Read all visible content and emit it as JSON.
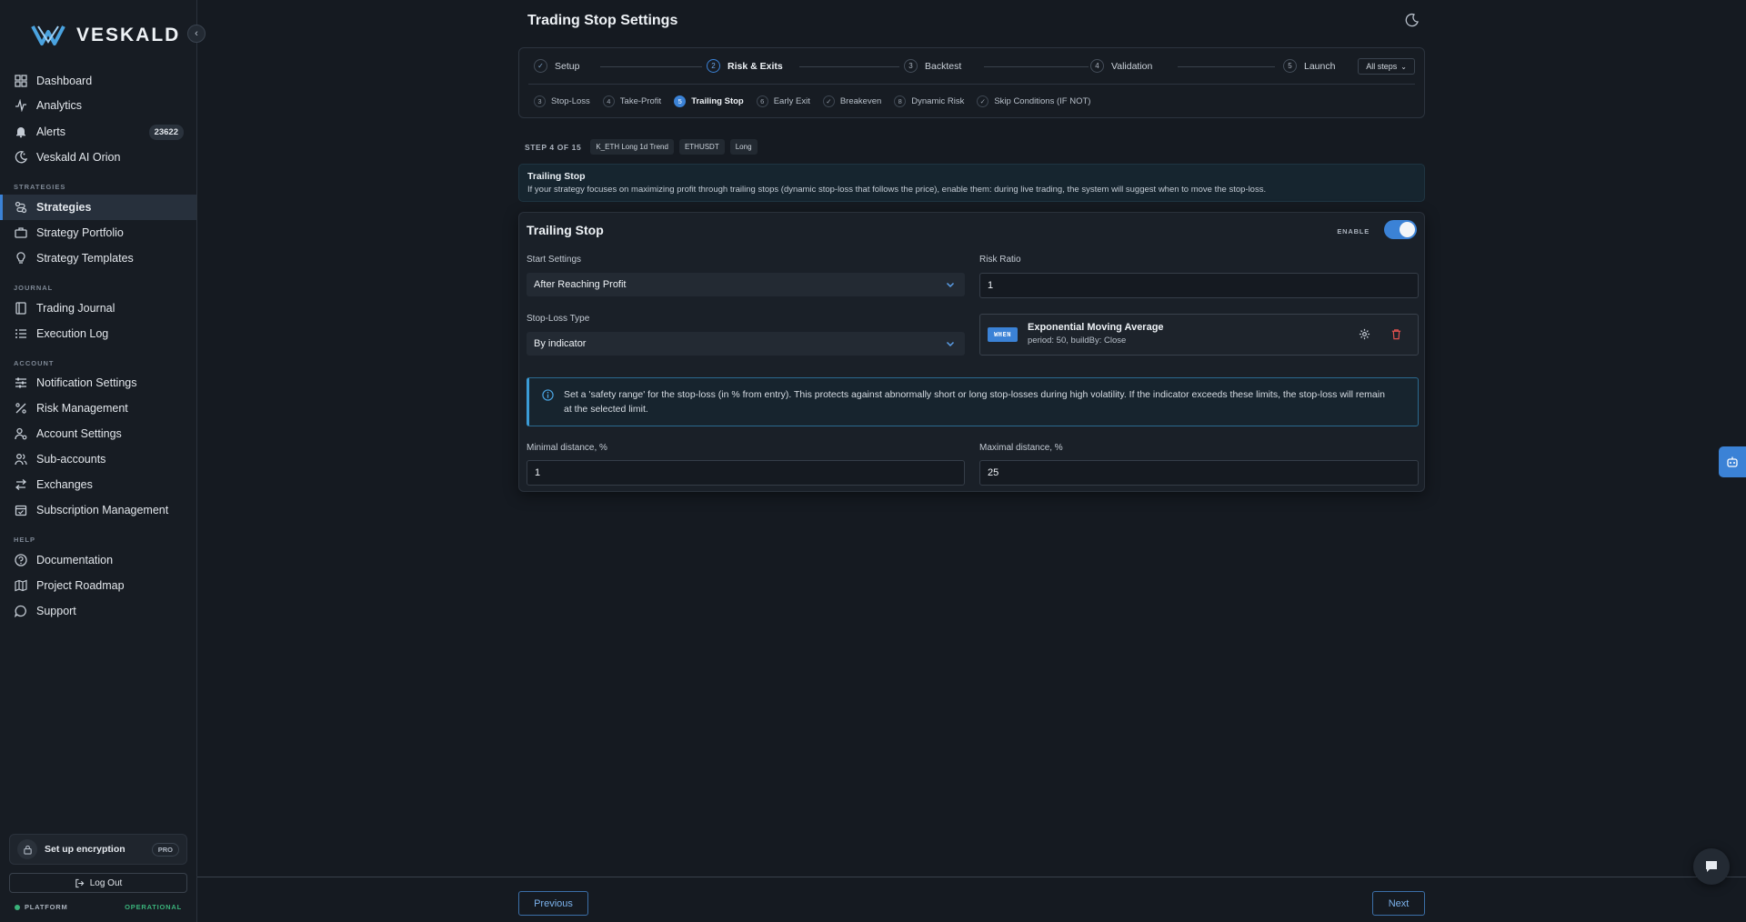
{
  "brand": {
    "name": "VESKALD"
  },
  "sidebar": {
    "main_items": [
      {
        "label": "Dashboard",
        "icon": "dashboard-icon"
      },
      {
        "label": "Analytics",
        "icon": "analytics-icon"
      },
      {
        "label": "Alerts",
        "icon": "bell-icon",
        "badge": "23622"
      },
      {
        "label": "Veskald AI Orion",
        "icon": "ai-orion-icon"
      }
    ],
    "sections": {
      "strategies": "STRATEGIES",
      "journal": "JOURNAL",
      "account": "ACCOUNT",
      "help": "HELP"
    },
    "strategies_items": [
      {
        "label": "Strategies",
        "active": true
      },
      {
        "label": "Strategy Portfolio"
      },
      {
        "label": "Strategy Templates"
      }
    ],
    "journal_items": [
      {
        "label": "Trading Journal"
      },
      {
        "label": "Execution Log"
      }
    ],
    "account_items": [
      {
        "label": "Notification Settings"
      },
      {
        "label": "Risk Management"
      },
      {
        "label": "Account Settings"
      },
      {
        "label": "Sub-accounts"
      },
      {
        "label": "Exchanges"
      },
      {
        "label": "Subscription Management"
      }
    ],
    "help_items": [
      {
        "label": "Documentation"
      },
      {
        "label": "Project Roadmap"
      },
      {
        "label": "Support"
      }
    ],
    "encryption": {
      "label": "Set up encryption",
      "badge": "PRO"
    },
    "logout": "Log Out",
    "platform": {
      "label": "PLATFORM",
      "status": "OPERATIONAL",
      "status_color": "#3ab27a"
    }
  },
  "page": {
    "title": "Trading Stop Settings"
  },
  "stepper": {
    "steps": [
      {
        "num": "✓",
        "label": "Setup"
      },
      {
        "num": "2",
        "label": "Risk & Exits",
        "current": true
      },
      {
        "num": "3",
        "label": "Backtest"
      },
      {
        "num": "4",
        "label": "Validation"
      },
      {
        "num": "5",
        "label": "Launch"
      }
    ],
    "all_steps": "All steps",
    "substeps": [
      {
        "num": "3",
        "label": "Stop-Loss"
      },
      {
        "num": "4",
        "label": "Take-Profit"
      },
      {
        "num": "5",
        "label": "Trailing Stop",
        "current": true
      },
      {
        "num": "6",
        "label": "Early Exit"
      },
      {
        "num": "✓",
        "label": "Breakeven"
      },
      {
        "num": "8",
        "label": "Dynamic Risk"
      },
      {
        "num": "✓",
        "label": "Skip Conditions (IF NOT)"
      }
    ]
  },
  "meta": {
    "step_label": "STEP 4 OF 15",
    "chips": [
      "K_ETH Long 1d Trend",
      "ETHUSDT",
      "Long"
    ]
  },
  "banner": {
    "title": "Trailing Stop",
    "description": "If your strategy focuses on maximizing profit through trailing stops (dynamic stop-loss that follows the price), enable them: during live trading, the system will suggest when to move the stop-loss."
  },
  "card": {
    "title": "Trailing Stop",
    "enable_label": "ENABLE",
    "enabled": true,
    "start_settings": {
      "label": "Start Settings",
      "value": "After Reaching Profit"
    },
    "risk_ratio": {
      "label": "Risk Ratio",
      "value": "1"
    },
    "stop_loss_type": {
      "label": "Stop-Loss Type",
      "value": "By indicator"
    },
    "indicator": {
      "badge": "WHEN",
      "name": "Exponential Moving Average",
      "params": "period: 50, buildBy: Close"
    },
    "safety_text": "Set a 'safety range' for the stop-loss (in % from entry). This protects against abnormally short or long stop-losses during high volatility. If the indicator exceeds these limits, the stop-loss will remain at the selected limit.",
    "min_distance": {
      "label": "Minimal distance, %",
      "value": "1"
    },
    "max_distance": {
      "label": "Maximal distance, %",
      "value": "25"
    }
  },
  "footer": {
    "previous": "Previous",
    "next": "Next"
  },
  "colors": {
    "accent": "#3b82d6",
    "danger": "#e0524f",
    "background": "#151a21"
  }
}
